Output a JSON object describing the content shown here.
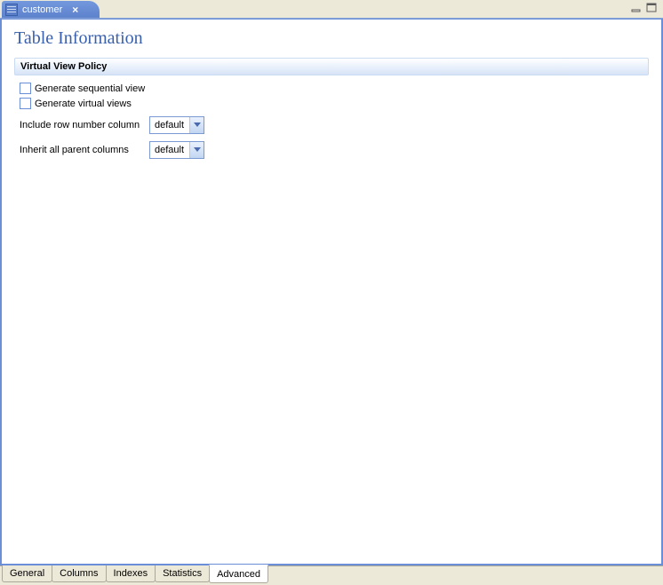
{
  "editor_tab": {
    "label": "customer"
  },
  "page_title": "Table Information",
  "section": {
    "title": "Virtual View Policy",
    "check_sequential": "Generate sequential view",
    "check_virtual": "Generate virtual views",
    "row_number_label": "Include row number column",
    "row_number_value": "default",
    "inherit_label": "Inherit all parent columns",
    "inherit_value": "default"
  },
  "bottom_tabs": {
    "general": "General",
    "columns": "Columns",
    "indexes": "Indexes",
    "statistics": "Statistics",
    "advanced": "Advanced"
  }
}
